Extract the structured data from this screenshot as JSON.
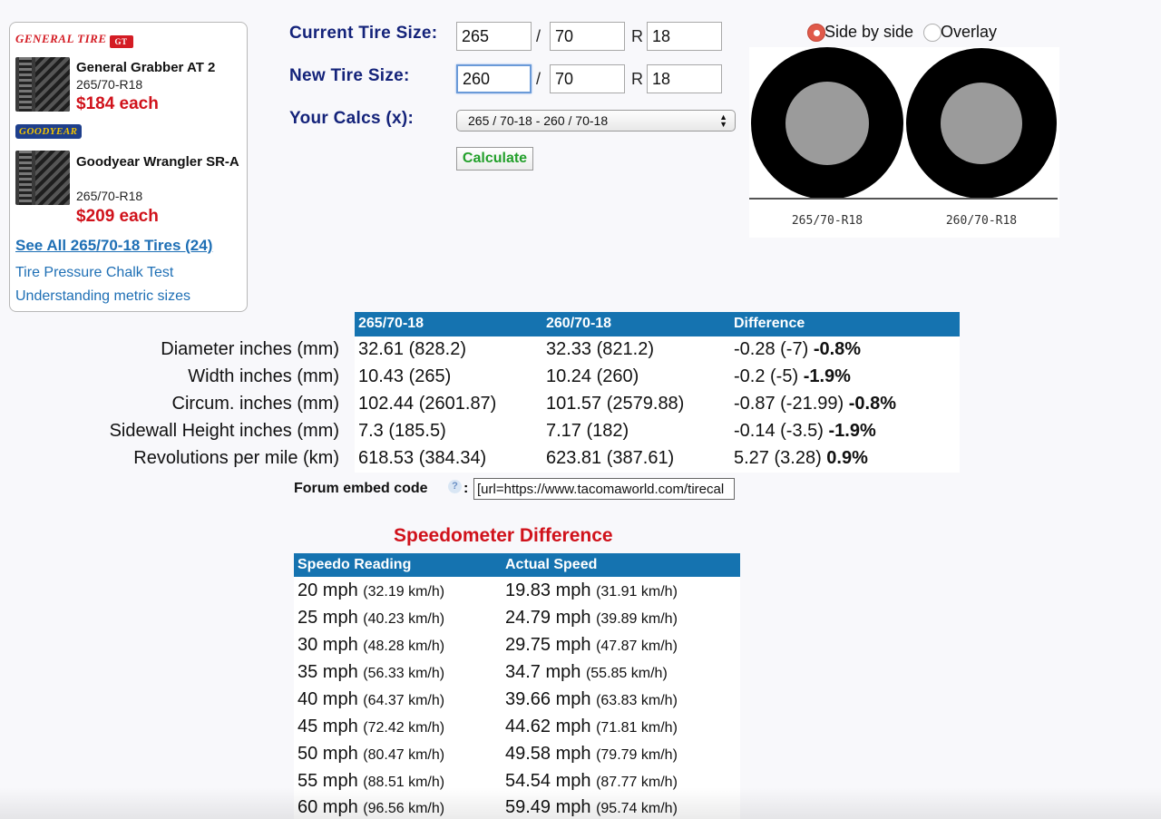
{
  "ads": {
    "general_logo": "GENERAL TIRE",
    "general_badge": "GT",
    "goodyear_logo": "GOODYEAR",
    "tires": [
      {
        "name": "General Grabber AT 2",
        "size": "265/70-R18",
        "price": "$184 each"
      },
      {
        "name": "Goodyear Wrangler SR-A",
        "size": "265/70-R18",
        "price": "$209 each"
      }
    ],
    "see_all": "See All 265/70-18 Tires (24)",
    "links": [
      "Tire Pressure Chalk Test",
      "Understanding metric sizes"
    ]
  },
  "form": {
    "current_label": "Current Tire Size:",
    "new_label": "New Tire Size:",
    "calcs_label": "Your Calcs (x):",
    "current": {
      "width": "265",
      "ratio": "70",
      "rim": "18"
    },
    "new": {
      "width": "260",
      "ratio": "70",
      "rim": "18"
    },
    "slash": "/",
    "r": "R",
    "calcs_selected": "265 / 70-18 - 260 / 70-18",
    "calculate": "Calculate"
  },
  "visual": {
    "side_by_side": "Side by side",
    "overlay": "Overlay",
    "selected": "side_by_side",
    "tire1_label": "265/70-R18",
    "tire2_label": "260/70-R18"
  },
  "results": {
    "headers": [
      "265/70-18",
      "260/70-18",
      "Difference"
    ],
    "rows": [
      {
        "label": "Diameter inches (mm)",
        "a": "32.61 (828.2)",
        "b": "32.33 (821.2)",
        "diff": "-0.28 (-7)",
        "pct": "-0.8%"
      },
      {
        "label": "Width inches (mm)",
        "a": "10.43 (265)",
        "b": "10.24 (260)",
        "diff": "-0.2 (-5)",
        "pct": "-1.9%"
      },
      {
        "label": "Circum. inches (mm)",
        "a": "102.44 (2601.87)",
        "b": "101.57 (2579.88)",
        "diff": "-0.87 (-21.99)",
        "pct": "-0.8%"
      },
      {
        "label": "Sidewall Height inches (mm)",
        "a": "7.3 (185.5)",
        "b": "7.17 (182)",
        "diff": "-0.14 (-3.5)",
        "pct": "-1.9%"
      },
      {
        "label": "Revolutions per mile (km)",
        "a": "618.53 (384.34)",
        "b": "623.81 (387.61)",
        "diff": "5.27 (3.28)",
        "pct": "0.9%"
      }
    ]
  },
  "embed": {
    "label": "Forum embed code",
    "help": "?",
    "colon": ":",
    "value": "[url=https://www.tacomaworld.com/tirecal"
  },
  "speedo": {
    "title": "Speedometer Difference",
    "headers": [
      "Speedo Reading",
      "Actual Speed"
    ],
    "rows": [
      {
        "reading": "20 mph",
        "reading_km": "(32.19 km/h)",
        "actual": "19.83 mph",
        "actual_km": "(31.91 km/h)"
      },
      {
        "reading": "25 mph",
        "reading_km": "(40.23 km/h)",
        "actual": "24.79 mph",
        "actual_km": "(39.89 km/h)"
      },
      {
        "reading": "30 mph",
        "reading_km": "(48.28 km/h)",
        "actual": "29.75 mph",
        "actual_km": "(47.87 km/h)"
      },
      {
        "reading": "35 mph",
        "reading_km": "(56.33 km/h)",
        "actual": "34.7 mph",
        "actual_km": "(55.85 km/h)"
      },
      {
        "reading": "40 mph",
        "reading_km": "(64.37 km/h)",
        "actual": "39.66 mph",
        "actual_km": "(63.83 km/h)"
      },
      {
        "reading": "45 mph",
        "reading_km": "(72.42 km/h)",
        "actual": "44.62 mph",
        "actual_km": "(71.81 km/h)"
      },
      {
        "reading": "50 mph",
        "reading_km": "(80.47 km/h)",
        "actual": "49.58 mph",
        "actual_km": "(79.79 km/h)"
      },
      {
        "reading": "55 mph",
        "reading_km": "(88.51 km/h)",
        "actual": "54.54 mph",
        "actual_km": "(87.77 km/h)"
      },
      {
        "reading": "60 mph",
        "reading_km": "(96.56 km/h)",
        "actual": "59.49 mph",
        "actual_km": "(95.74 km/h)"
      }
    ]
  },
  "colors": {
    "header_blue": "#1573b0",
    "label_navy": "#14237a",
    "price_red": "#d0121b",
    "link_blue": "#1e6fb5",
    "calc_green": "#23a02b",
    "radio_selected": "#e05a4a"
  }
}
